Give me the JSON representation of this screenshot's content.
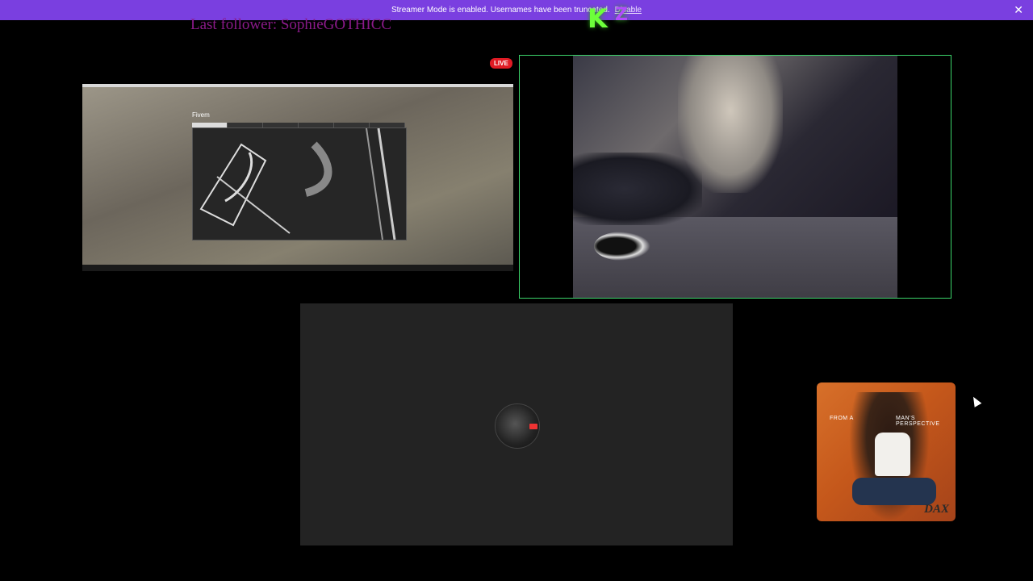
{
  "banner": {
    "message": "Streamer Mode is enabled. Usernames have been truncated.",
    "link": "Disable",
    "close_icon": "close-icon"
  },
  "overlay": {
    "last_follower": "Last follower: SophieGOTHICC",
    "logo_letter": "K",
    "logo_sub": "Z"
  },
  "stream": {
    "live_badge": "LIVE"
  },
  "game": {
    "menu_title": "Fivem"
  },
  "album": {
    "caption_left": "FROM A",
    "caption_right": "MAN'S PERSPECTIVE",
    "artist": "DAX"
  },
  "colors": {
    "banner": "#7a3fe0",
    "cam_border": "#3cd46a",
    "live": "#e01b24"
  }
}
